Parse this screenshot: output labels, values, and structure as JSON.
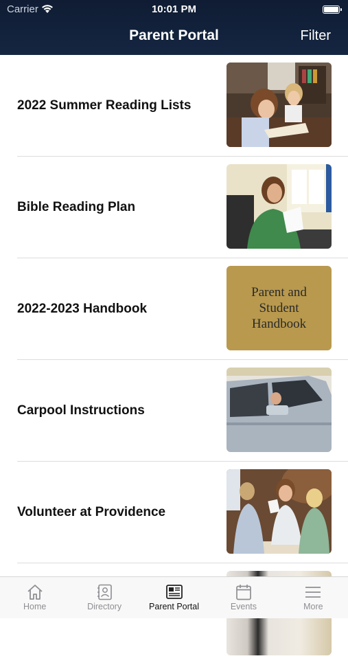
{
  "status_bar": {
    "carrier": "Carrier",
    "time": "10:01 PM"
  },
  "nav": {
    "title": "Parent Portal",
    "filter_label": "Filter"
  },
  "items": [
    {
      "title": "2022 Summer Reading Lists",
      "thumb": "reading-photo"
    },
    {
      "title": "Bible Reading Plan",
      "thumb": "teacher-photo"
    },
    {
      "title": "2022-2023 Handbook",
      "thumb": "handbook-cover",
      "cover_text": [
        "Parent and",
        "Student",
        "Handbook"
      ]
    },
    {
      "title": "Carpool Instructions",
      "thumb": "car-photo"
    },
    {
      "title": "Volunteer at Providence",
      "thumb": "volunteer-photo"
    }
  ],
  "tabs": [
    {
      "label": "Home",
      "icon": "home-icon"
    },
    {
      "label": "Directory",
      "icon": "contacts-icon"
    },
    {
      "label": "Parent Portal",
      "icon": "newspaper-icon",
      "active": true
    },
    {
      "label": "Events",
      "icon": "calendar-icon"
    },
    {
      "label": "More",
      "icon": "menu-icon"
    }
  ],
  "colors": {
    "header": "#132240",
    "handbook_gold": "#b8994e",
    "active_tab": "#111111",
    "inactive_tab": "#8e8e93"
  }
}
